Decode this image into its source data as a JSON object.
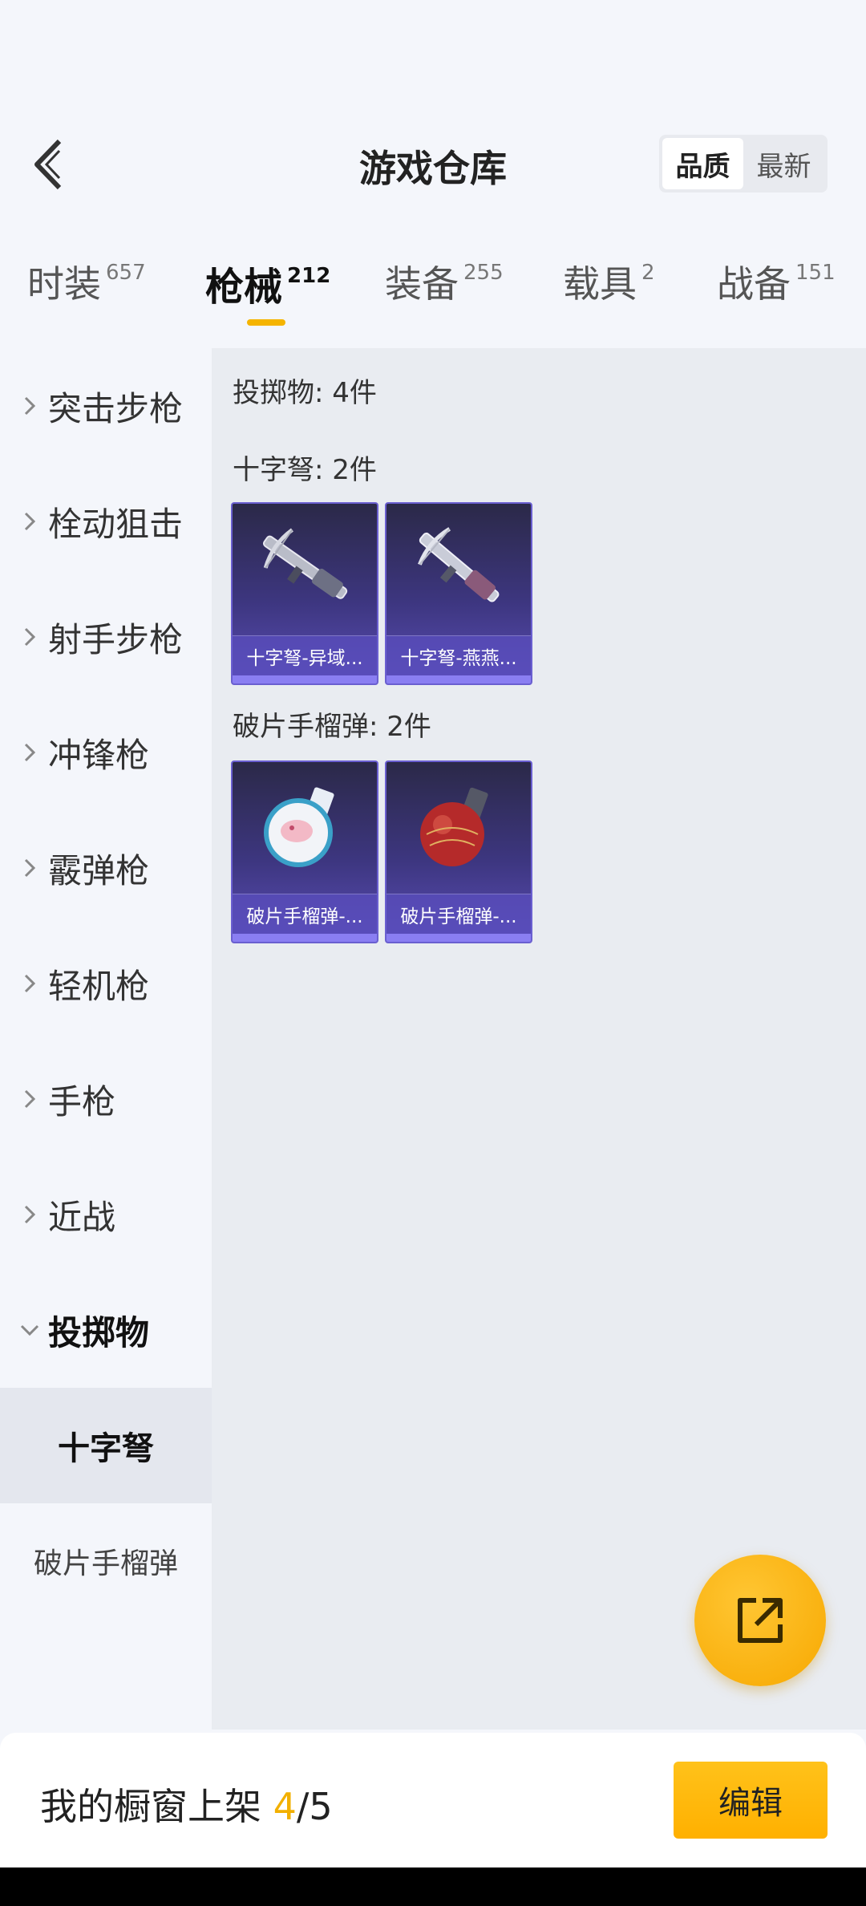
{
  "header": {
    "title": "游戏仓库",
    "sort": [
      "品质",
      "最新"
    ],
    "sort_active": 0
  },
  "tabs": [
    {
      "label": "时装",
      "count": "657"
    },
    {
      "label": "枪械",
      "count": "212"
    },
    {
      "label": "装备",
      "count": "255"
    },
    {
      "label": "载具",
      "count": "2"
    },
    {
      "label": "战备",
      "count": "151"
    }
  ],
  "active_tab": 1,
  "sidebar": {
    "categories": [
      "突击步枪",
      "栓动狙击",
      "射手步枪",
      "冲锋枪",
      "霰弹枪",
      "轻机枪",
      "手枪",
      "近战",
      "投掷物"
    ],
    "open_category": "投掷物",
    "subcategories": [
      "十字弩",
      "破片手榴弹"
    ],
    "selected_sub": "十字弩"
  },
  "content": {
    "summary": "投掷物: 4件",
    "sections": [
      {
        "title": "十字弩: 2件",
        "items": [
          "十字弩-异域...",
          "十字弩-燕燕..."
        ]
      },
      {
        "title": "破片手榴弹: 2件",
        "items": [
          "破片手榴弹-...",
          "破片手榴弹-..."
        ]
      }
    ]
  },
  "bottom": {
    "showcase_label": "我的橱窗上架",
    "showcase_count": "4",
    "showcase_total": "/5",
    "edit_label": "编辑"
  },
  "colors": {
    "accent": "#f5b400",
    "card_bg": "#3d3680"
  }
}
